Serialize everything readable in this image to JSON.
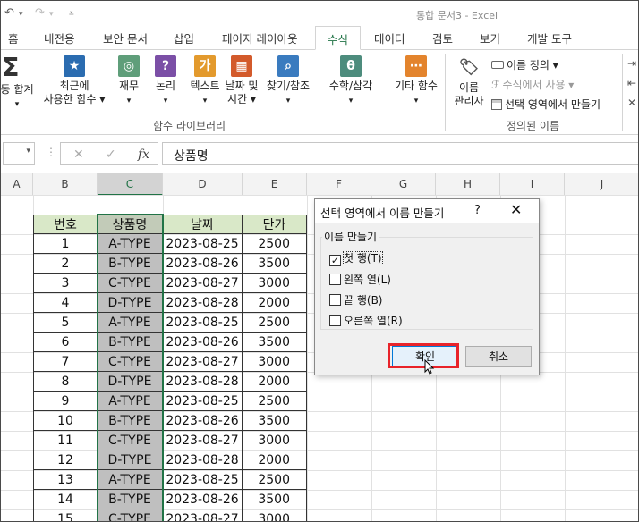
{
  "window": {
    "title": "통합 문서3 - Excel"
  },
  "tabs": [
    {
      "label": "홈",
      "active": false
    },
    {
      "label": "내전용",
      "active": false
    },
    {
      "label": "보안 문서",
      "active": false
    },
    {
      "label": "삽입",
      "active": false
    },
    {
      "label": "페이지 레이아웃",
      "active": false
    },
    {
      "label": "수식",
      "active": true
    },
    {
      "label": "데이터",
      "active": false
    },
    {
      "label": "검토",
      "active": false
    },
    {
      "label": "보기",
      "active": false
    },
    {
      "label": "개발 도구",
      "active": false
    }
  ],
  "ribbon": {
    "autosum_line1": "동 합계",
    "autosum_arrow": "▾",
    "recent_line1": "최근에",
    "recent_line2": "사용한 함수 ▾",
    "finance": "재무",
    "finance_arrow": "▾",
    "logic": "논리",
    "logic_arrow": "▾",
    "text": "텍스트",
    "text_arrow": "▾",
    "datetime_line1": "날짜 및",
    "datetime_line2": "시간 ▾",
    "lookup": "찾기/참조",
    "lookup_arrow": "▾",
    "math": "수학/삼각",
    "math_arrow": "▾",
    "more": "기타 함수",
    "more_arrow": "▾",
    "library_label": "함수 라이브러리",
    "name_manager_line1": "이름",
    "name_manager_line2": "관리자",
    "define_name": "이름 정의 ▾",
    "use_in_formula": "수식에서 사용 ▾",
    "create_from_selection": "선택 영역에서 만들기",
    "defined_names_label": "정의된 이름"
  },
  "formula_bar": {
    "name_box_value": "",
    "formula_value": "상품명"
  },
  "columns": [
    "A",
    "B",
    "C",
    "D",
    "E",
    "F",
    "G",
    "H",
    "I",
    "J"
  ],
  "table": {
    "headers": [
      "번호",
      "상품명",
      "날짜",
      "단가"
    ],
    "rows": [
      [
        "1",
        "A-TYPE",
        "2023-08-25",
        "2500"
      ],
      [
        "2",
        "B-TYPE",
        "2023-08-26",
        "3500"
      ],
      [
        "3",
        "C-TYPE",
        "2023-08-27",
        "3000"
      ],
      [
        "4",
        "D-TYPE",
        "2023-08-28",
        "2000"
      ],
      [
        "5",
        "A-TYPE",
        "2023-08-25",
        "2500"
      ],
      [
        "6",
        "B-TYPE",
        "2023-08-26",
        "3500"
      ],
      [
        "7",
        "C-TYPE",
        "2023-08-27",
        "3000"
      ],
      [
        "8",
        "D-TYPE",
        "2023-08-28",
        "2000"
      ],
      [
        "9",
        "A-TYPE",
        "2023-08-25",
        "2500"
      ],
      [
        "10",
        "B-TYPE",
        "2023-08-26",
        "3500"
      ],
      [
        "11",
        "C-TYPE",
        "2023-08-27",
        "3000"
      ],
      [
        "12",
        "D-TYPE",
        "2023-08-28",
        "2000"
      ],
      [
        "13",
        "A-TYPE",
        "2023-08-25",
        "2500"
      ],
      [
        "14",
        "B-TYPE",
        "2023-08-26",
        "3500"
      ],
      [
        "15",
        "C-TYPE",
        "2023-08-27",
        "3000"
      ]
    ]
  },
  "dialog": {
    "title": "선택 영역에서 이름 만들기",
    "help": "?",
    "close": "✕",
    "group_label": "이름 만들기",
    "options": [
      {
        "label": "첫 행(T)",
        "checked": true
      },
      {
        "label": "왼쪽 열(L)",
        "checked": false
      },
      {
        "label": "끝 행(B)",
        "checked": false
      },
      {
        "label": "오른쪽 열(R)",
        "checked": false
      }
    ],
    "ok_label": "확인",
    "cancel_label": "취소"
  },
  "colors": {
    "excel_green": "#217346",
    "header_fill": "#d9e8c8",
    "selected_fill": "#bfbfbf",
    "highlight_red": "#e8232a"
  }
}
